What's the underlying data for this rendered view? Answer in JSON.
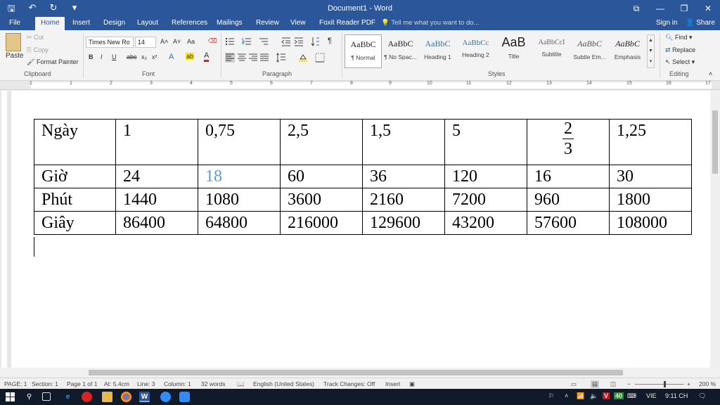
{
  "window": {
    "title": "Document1 - Word",
    "qat": {
      "save": "🖫",
      "undo": "↶",
      "redo": "↻",
      "customize": "▾"
    },
    "controls": {
      "ribbon_display": "⧉",
      "minimize": "—",
      "restore": "❐",
      "close": "✕"
    }
  },
  "tabs": [
    {
      "label": "File"
    },
    {
      "label": "Home"
    },
    {
      "label": "Insert"
    },
    {
      "label": "Design"
    },
    {
      "label": "Layout"
    },
    {
      "label": "References"
    },
    {
      "label": "Mailings"
    },
    {
      "label": "Review"
    },
    {
      "label": "View"
    },
    {
      "label": "Foxit Reader PDF"
    }
  ],
  "tell_me": "Tell me what you want to do...",
  "account": {
    "sign_in": "Sign in",
    "share": "Share"
  },
  "clipboard": {
    "paste": "Paste",
    "cut": "Cut",
    "copy": "Copy",
    "format_painter": "Format Painter",
    "label": "Clipboard"
  },
  "font": {
    "name": "Times New Ro",
    "size": "14",
    "label": "Font",
    "buttons": {
      "bold": "B",
      "italic": "I",
      "underline": "U",
      "strike": "abc",
      "subscript": "x₂",
      "superscript": "x²",
      "grow": "A˄",
      "shrink": "A˅",
      "case": "Aa",
      "clear": "⌫",
      "effects": "A",
      "highlight": "ab",
      "color": "A"
    }
  },
  "paragraph": {
    "label": "Paragraph",
    "show_marks": "¶"
  },
  "styles": {
    "label": "Styles",
    "items": [
      {
        "sample": "AaBbC",
        "name": "¶ Normal"
      },
      {
        "sample": "AaBbC",
        "name": "¶ No Spac..."
      },
      {
        "sample": "AaBbC",
        "name": "Heading 1"
      },
      {
        "sample": "AaBbCc",
        "name": "Heading 2"
      },
      {
        "sample": "AaB",
        "name": "Title"
      },
      {
        "sample": "AaBbCcI",
        "name": "Subtitle"
      },
      {
        "sample": "AaBbC",
        "name": "Subtle Em..."
      },
      {
        "sample": "AaBbC",
        "name": "Emphasis"
      }
    ]
  },
  "editing": {
    "label": "Editing",
    "find": "Find",
    "replace": "Replace",
    "select": "Select"
  },
  "ruler": {
    "numbers": [
      "1",
      "1",
      "2",
      "3",
      "4",
      "5",
      "6",
      "7",
      "8",
      "9",
      "10",
      "11",
      "12",
      "13",
      "14",
      "15",
      "16",
      "17"
    ]
  },
  "table": {
    "rows": [
      {
        "label": "Ngày",
        "cells": [
          "1",
          "0,75",
          "2,5",
          "1,5",
          "5",
          "",
          "1,25"
        ],
        "fraction": {
          "numerator": "2",
          "denominator": "3"
        }
      },
      {
        "label": "Giờ",
        "cells": [
          "24",
          "18",
          "60",
          "36",
          "120",
          "16",
          "30"
        ]
      },
      {
        "label": "Phút",
        "cells": [
          "1440",
          "1080",
          "3600",
          "2160",
          "7200",
          "960",
          "1800"
        ]
      },
      {
        "label": "Giây",
        "cells": [
          "86400",
          "64800",
          "216000",
          "129600",
          "43200",
          "57600",
          "108000"
        ]
      }
    ],
    "highlight_color": "#5b9bd5"
  },
  "status": {
    "page": "PAGE: 1",
    "section": "Section: 1",
    "page_of": "Page 1 of 1",
    "at": "At: 5.4cm",
    "line": "Line: 3",
    "column": "Column: 1",
    "words": "32 words",
    "language": "English (United States)",
    "track": "Track Changes: Off",
    "mode": "Insert",
    "zoom": "200 %"
  },
  "taskbar": {
    "lang": "VIE",
    "time": "9:11 CH",
    "battery": "40"
  },
  "colors": {
    "accent": "#2b579a",
    "taskbar": "#101a2a"
  }
}
